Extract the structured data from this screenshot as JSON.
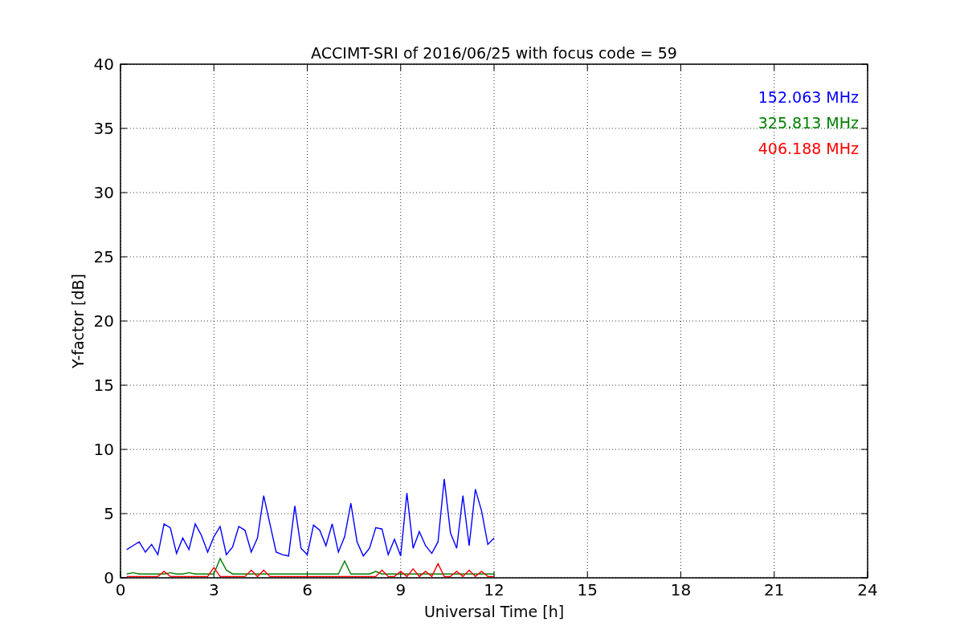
{
  "chart_data": {
    "type": "line",
    "grid": true,
    "title": "ACCIMT-SRI of 2016/06/25 with focus code = 59",
    "xlabel": "Universal Time [h]",
    "ylabel": "Y-factor [dB]",
    "xlim": [
      0,
      24
    ],
    "ylim": [
      0,
      40
    ],
    "xticks": [
      0,
      3,
      6,
      9,
      12,
      15,
      18,
      21,
      24
    ],
    "yticks": [
      0,
      5,
      10,
      15,
      20,
      25,
      30,
      35,
      40
    ],
    "x": [
      0.2,
      0.4,
      0.6,
      0.8,
      1.0,
      1.2,
      1.4,
      1.6,
      1.8,
      2.0,
      2.2,
      2.4,
      2.6,
      2.8,
      3.0,
      3.2,
      3.4,
      3.6,
      3.8,
      4.0,
      4.2,
      4.4,
      4.6,
      4.8,
      5.0,
      5.2,
      5.4,
      5.6,
      5.8,
      6.0,
      6.2,
      6.4,
      6.6,
      6.8,
      7.0,
      7.2,
      7.4,
      7.6,
      7.8,
      8.0,
      8.2,
      8.4,
      8.6,
      8.8,
      9.0,
      9.2,
      9.4,
      9.6,
      9.8,
      10.0,
      10.2,
      10.4,
      10.6,
      10.8,
      11.0,
      11.2,
      11.4,
      11.6,
      11.8,
      12.0
    ],
    "series": [
      {
        "name": "152.063 MHz",
        "color": "#0000ff",
        "values": [
          2.2,
          2.5,
          2.8,
          2.0,
          2.6,
          1.8,
          4.2,
          3.9,
          1.9,
          3.1,
          2.2,
          4.2,
          3.3,
          2.0,
          3.2,
          4.0,
          1.8,
          2.4,
          4.0,
          3.7,
          2.0,
          3.1,
          6.4,
          4.2,
          2.0,
          1.8,
          1.7,
          5.6,
          2.3,
          1.8,
          4.1,
          3.7,
          2.5,
          4.2,
          2.0,
          3.2,
          5.8,
          2.8,
          1.7,
          2.3,
          3.9,
          3.8,
          1.8,
          3.0,
          1.7,
          6.6,
          2.3,
          3.6,
          2.5,
          1.9,
          2.8,
          7.7,
          3.5,
          2.3,
          6.4,
          2.5,
          6.9,
          5.2,
          2.6,
          3.1
        ]
      },
      {
        "name": "325.813 MHz",
        "color": "#008000",
        "values": [
          0.3,
          0.4,
          0.3,
          0.3,
          0.3,
          0.3,
          0.3,
          0.4,
          0.3,
          0.3,
          0.4,
          0.3,
          0.3,
          0.3,
          0.3,
          1.5,
          0.6,
          0.3,
          0.3,
          0.3,
          0.3,
          0.3,
          0.3,
          0.3,
          0.3,
          0.3,
          0.3,
          0.3,
          0.3,
          0.3,
          0.3,
          0.3,
          0.3,
          0.3,
          0.3,
          1.3,
          0.3,
          0.3,
          0.3,
          0.3,
          0.5,
          0.3,
          0.3,
          0.3,
          0.3,
          0.3,
          0.3,
          0.3,
          0.3,
          0.3,
          0.3,
          0.3,
          0.3,
          0.3,
          0.3,
          0.3,
          0.3,
          0.3,
          0.3,
          0.3
        ]
      },
      {
        "name": "406.188 MHz",
        "color": "#ff0000",
        "values": [
          0.1,
          0.1,
          0.1,
          0.1,
          0.1,
          0.1,
          0.5,
          0.1,
          0.1,
          0.1,
          0.1,
          0.1,
          0.1,
          0.1,
          0.8,
          0.1,
          0.1,
          0.1,
          0.1,
          0.1,
          0.6,
          0.1,
          0.6,
          0.1,
          0.1,
          0.1,
          0.1,
          0.1,
          0.1,
          0.1,
          0.1,
          0.1,
          0.1,
          0.1,
          0.1,
          0.1,
          0.1,
          0.1,
          0.1,
          0.1,
          0.1,
          0.6,
          0.1,
          0.1,
          0.5,
          0.1,
          0.7,
          0.1,
          0.5,
          0.1,
          1.1,
          0.1,
          0.1,
          0.5,
          0.1,
          0.6,
          0.1,
          0.5,
          0.1,
          0.1
        ]
      }
    ]
  }
}
